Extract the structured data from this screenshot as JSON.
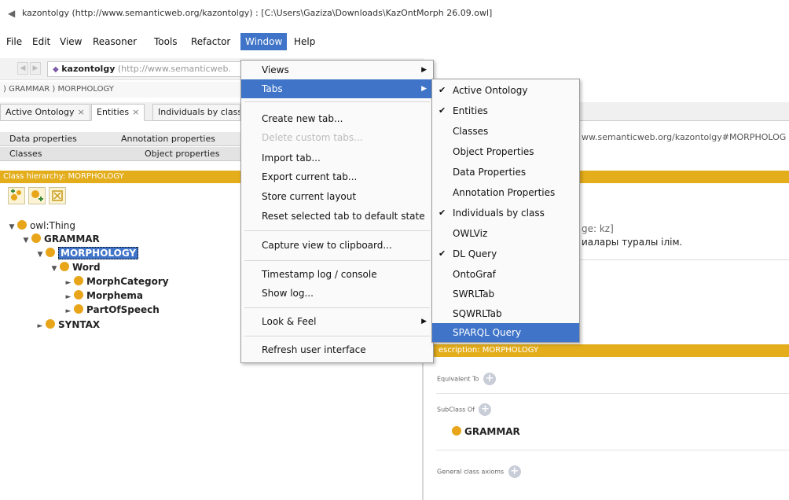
{
  "window": {
    "title": "kazontolgy (http://www.semanticweb.org/kazontolgy) : [C:\\Users\\Gaziza\\Downloads\\KazOntMorph 26.09.owl]",
    "icon": "protege-icon"
  },
  "menubar": [
    "File",
    "Edit",
    "View",
    "Reasoner",
    "Tools",
    "Refactor",
    "Window",
    "Help"
  ],
  "active_menu": "Window",
  "nav": {
    "ontology_name": "kazontolgy",
    "ontology_iri": "(http://www.semanticweb.",
    "breadcrumb": ") GRAMMAR ) MORPHOLOGY"
  },
  "tabs": [
    {
      "label": "Active Ontology",
      "close": "×"
    },
    {
      "label": "Entities",
      "close": "×"
    },
    {
      "label": "Individuals by class"
    }
  ],
  "entity_subtabs": {
    "row1": [
      "Data properties",
      "Annotation properties"
    ],
    "row2": [
      "Classes",
      "Object properties"
    ]
  },
  "class_hierarchy": {
    "header": "Class hierarchy: MORPHOLOGY",
    "tree": [
      {
        "label": "owl:Thing",
        "bold": false
      },
      {
        "label": "GRAMMAR",
        "bold": true
      },
      {
        "label": "MORPHOLOGY",
        "bold": true,
        "selected": true
      },
      {
        "label": "Word",
        "bold": true
      },
      {
        "label": "MorphCategory",
        "bold": true
      },
      {
        "label": "Morphema",
        "bold": true
      },
      {
        "label": "PartOfSpeech",
        "bold": true
      },
      {
        "label": "SYNTAX",
        "bold": true
      }
    ]
  },
  "right_panel": {
    "iri_fragment": "ww.semanticweb.org/kazontolgy#MORPHOLOG",
    "annotation_lang": "ge: kz]",
    "annotation_text": "иалары туралы ілім.",
    "description_header": "escription: MORPHOLOGY",
    "equivalent_label": "Equivalent To",
    "subclass_label": "SubClass Of",
    "superclass": "GRAMMAR",
    "general_axioms_label": "General class axioms"
  },
  "window_menu": {
    "items": [
      {
        "label": "Views",
        "submenu": true
      },
      {
        "label": "Tabs",
        "submenu": true,
        "highlighted": true
      },
      {
        "label": "Create new tab..."
      },
      {
        "label": "Delete custom tabs...",
        "disabled": true
      },
      {
        "label": "Import tab..."
      },
      {
        "label": "Export current tab..."
      },
      {
        "label": "Store current layout"
      },
      {
        "label": "Reset selected tab to default state"
      },
      {
        "label": "Capture view to clipboard..."
      },
      {
        "label": "Timestamp log / console"
      },
      {
        "label": "Show log..."
      },
      {
        "label": "Look & Feel",
        "submenu": true
      },
      {
        "label": "Refresh user interface"
      }
    ]
  },
  "tabs_submenu": {
    "items": [
      {
        "label": "Active Ontology",
        "checked": true
      },
      {
        "label": "Entities",
        "checked": true
      },
      {
        "label": "Classes",
        "checked": false
      },
      {
        "label": "Object Properties",
        "checked": false
      },
      {
        "label": "Data Properties",
        "checked": false
      },
      {
        "label": "Annotation Properties",
        "checked": false
      },
      {
        "label": "Individuals by class",
        "checked": true
      },
      {
        "label": "OWLViz",
        "checked": false
      },
      {
        "label": "DL Query",
        "checked": true
      },
      {
        "label": "OntoGraf",
        "checked": false
      },
      {
        "label": "SWRLTab",
        "checked": false
      },
      {
        "label": "SQWRLTab",
        "checked": false
      },
      {
        "label": "SPARQL Query",
        "checked": false,
        "highlighted": true
      }
    ],
    "check_glyph": "✔",
    "submenu_arrow": "▶"
  },
  "colors": {
    "accent": "#3f74c8",
    "header": "#e3ad1b",
    "class_dot": "#e8a51a"
  }
}
